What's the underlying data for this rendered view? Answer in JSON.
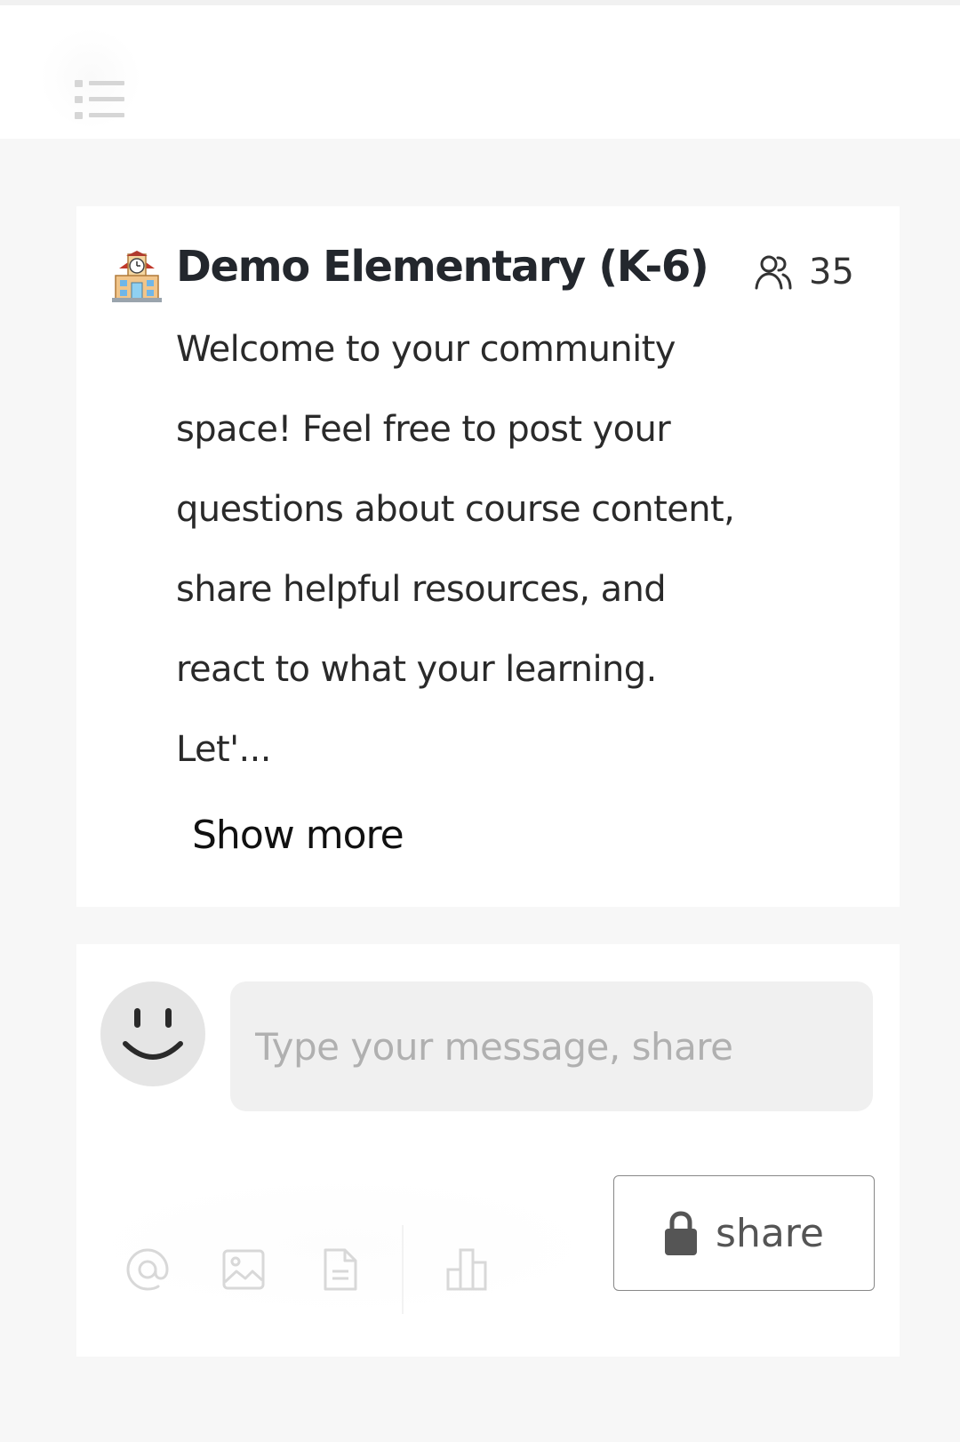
{
  "topbar": {
    "menu_icon": "list-icon"
  },
  "community": {
    "emoji": "school-building-icon",
    "title": "Demo Elementary (K-6)",
    "members_icon": "people-icon",
    "member_count": "35",
    "description": "Welcome to your community space! Feel free to post your questions about course content, share helpful resources, and react to what your learning. Let'...",
    "show_more_label": "Show more"
  },
  "composer": {
    "avatar_icon": "smiley-avatar-icon",
    "placeholder": "Type your message, share",
    "tools": [
      {
        "name": "mention-icon"
      },
      {
        "name": "image-icon"
      },
      {
        "name": "file-icon"
      },
      {
        "name": "poll-icon"
      }
    ],
    "share_button": {
      "icon": "lock-icon",
      "label": "share"
    }
  },
  "colors": {
    "page_background": "#f7f7f7",
    "card_background": "#ffffff",
    "input_background": "#f0f0f0",
    "title_text": "#23272d",
    "placeholder_text": "#b0b0b0",
    "toolbar_icon": "#d8d8d8"
  }
}
